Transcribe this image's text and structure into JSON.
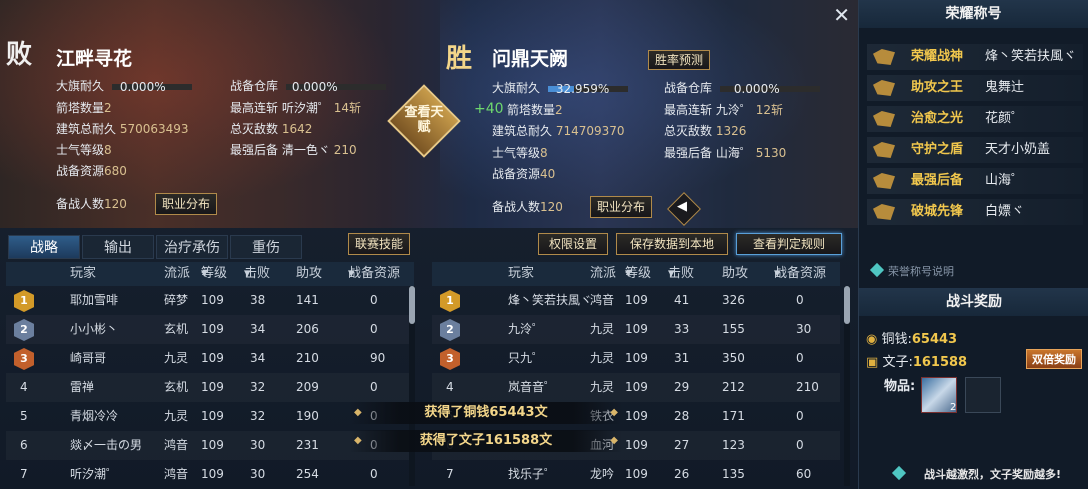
{
  "left": {
    "result": "败",
    "team": "江畔寻花",
    "stats": {
      "flag_label": "大旗耐久",
      "flag_value": "0.000%",
      "flag_pct": 0,
      "tower_label": "箭塔数量",
      "tower_value": "2",
      "build_label": "建筑总耐久",
      "build_value": "570063493",
      "morale_label": "士气等级",
      "morale_value": "8",
      "res_label": "战备资源",
      "res_value": "680",
      "depot_label": "战备仓库",
      "depot_value": "0.000%",
      "depot_pct": 0,
      "streak_label": "最高连斩",
      "streak_name": "听汐潮゜",
      "streak_value": "14斩",
      "kills_label": "总灭敌数",
      "kills_value": "1642",
      "backup_label": "最强后备",
      "backup_name": "清一色ヾ",
      "backup_value": "210"
    },
    "reserve_label": "备战人数",
    "reserve_value": "120",
    "job_button": "职业分布"
  },
  "right": {
    "result": "胜",
    "team": "问鼎天阙",
    "winrate_button": "胜率预测",
    "stats": {
      "flag_label": "大旗耐久",
      "flag_value": "32.959%",
      "flag_pct": 32.959,
      "tower_label": "箭塔数量",
      "tower_value": "2",
      "build_label": "建筑总耐久",
      "build_value": "714709370",
      "morale_label": "士气等级",
      "morale_value": "8",
      "res_label": "战备资源",
      "res_value": "40",
      "depot_label": "战备仓库",
      "depot_value": "0.000%",
      "depot_pct": 0,
      "streak_label": "最高连斩",
      "streak_name": "九泠゜",
      "streak_value": "12斩",
      "kills_label": "总灭敌数",
      "kills_value": "1326",
      "backup_label": "最强后备",
      "backup_name": "山海゜",
      "backup_value": "5130"
    },
    "morale_popup": "+40",
    "reserve_label": "备战人数",
    "reserve_value": "120",
    "job_button": "职业分布"
  },
  "talent_button": "查看天赋",
  "speaker_icon": "speaker-icon",
  "tabs": [
    "战略",
    "输出",
    "治疗承伤",
    "重伤"
  ],
  "league_button": "联赛技能",
  "perm_button": "权限设置",
  "save_button": "保存数据到本地",
  "rules_button": "查看判定规则",
  "columns": [
    "玩家",
    "流派",
    "等级",
    "击败",
    "助攻",
    "战备资源"
  ],
  "left_rows": [
    [
      "1",
      "耶加雪啡",
      "碎梦",
      "109",
      "38",
      "141",
      "0"
    ],
    [
      "2",
      "小小彬丶",
      "玄机",
      "109",
      "34",
      "206",
      "0"
    ],
    [
      "3",
      "崎哥哥",
      "九灵",
      "109",
      "34",
      "210",
      "90"
    ],
    [
      "4",
      "雷禅",
      "玄机",
      "109",
      "32",
      "209",
      "0"
    ],
    [
      "5",
      "青烟冷冷",
      "九灵",
      "109",
      "32",
      "190",
      "0"
    ],
    [
      "6",
      "燚〆一击の男",
      "鸿音",
      "109",
      "30",
      "231",
      "0"
    ],
    [
      "7",
      "听汐潮゜",
      "鸿音",
      "109",
      "30",
      "254",
      "0"
    ]
  ],
  "right_rows": [
    [
      "1",
      "烽丶笑若扶風ヾ",
      "鸿音",
      "109",
      "41",
      "326",
      "0"
    ],
    [
      "2",
      "九泠゜",
      "九灵",
      "109",
      "33",
      "155",
      "30"
    ],
    [
      "3",
      "只九゜",
      "九灵",
      "109",
      "31",
      "350",
      "0"
    ],
    [
      "4",
      "岚音音゜",
      "九灵",
      "109",
      "29",
      "212",
      "210"
    ],
    [
      "5",
      "",
      "铁衣",
      "109",
      "28",
      "171",
      "0"
    ],
    [
      "6",
      "",
      "血河",
      "109",
      "27",
      "123",
      "0"
    ],
    [
      "7",
      "找乐子゜",
      "龙吟",
      "109",
      "26",
      "135",
      "60"
    ]
  ],
  "toasts": [
    "获得了铜钱65443文",
    "获得了文子161588文"
  ],
  "honor": {
    "title": "荣耀称号",
    "items": [
      {
        "title": "荣耀战神",
        "name": "烽丶笑若扶風ヾ"
      },
      {
        "title": "助攻之王",
        "name": "鬼舞辻"
      },
      {
        "title": "治愈之光",
        "name": "花颜゜"
      },
      {
        "title": "守护之盾",
        "name": "天才小奶盖"
      },
      {
        "title": "最强后备",
        "name": "山海゜"
      },
      {
        "title": "破城先锋",
        "name": "白嫖ヾ"
      }
    ],
    "desc_link": "荣誉称号说明"
  },
  "rewards": {
    "title": "战斗奖励",
    "coin_label": "铜钱:",
    "coin_value": "65443",
    "wenzi_label": "文子:",
    "wenzi_value": "161588",
    "double_badge": "双倍奖励",
    "items_label": "物品:",
    "item_count": "2",
    "footer": "战斗越激烈，文子奖励越多!"
  },
  "colors": {
    "accent_gold": "#f1c74d",
    "win_gold": "#f3d68a",
    "tab_active": "#2f5d8a",
    "flag_bar": "#4a8fd6"
  }
}
